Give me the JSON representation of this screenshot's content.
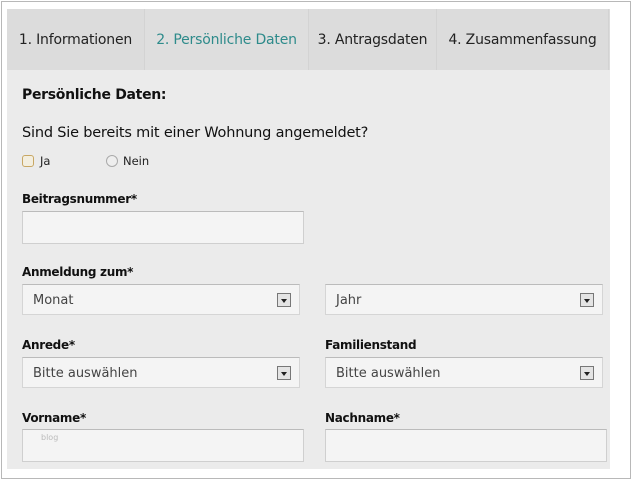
{
  "tabs": [
    {
      "label": "1. Informationen"
    },
    {
      "label": "2. Persönliche Daten",
      "active": true
    },
    {
      "label": "3. Antragsdaten"
    },
    {
      "label": "4. Zusammenfassung"
    }
  ],
  "section_title": "Persönliche Daten:",
  "question": "Sind Sie bereits mit einer Wohnung angemeldet?",
  "radio": {
    "yes": "Ja",
    "no": "Nein"
  },
  "fields": {
    "beitragsnummer": {
      "label": "Beitragsnummer*",
      "value": ""
    },
    "anmeldung": {
      "label": "Anmeldung zum*",
      "month": "Monat",
      "year": "Jahr"
    },
    "anrede": {
      "label": "Anrede*",
      "value": "Bitte auswählen"
    },
    "familienstand": {
      "label": "Familienstand",
      "value": "Bitte auswählen"
    },
    "vorname": {
      "label": "Vorname*",
      "value": "",
      "watermark": "blog"
    },
    "nachname": {
      "label": "Nachname*",
      "value": ""
    }
  },
  "colors": {
    "active_tab": "#2e8b8b",
    "panel": "#ebebeb",
    "tabbar": "#dcdcdc"
  }
}
